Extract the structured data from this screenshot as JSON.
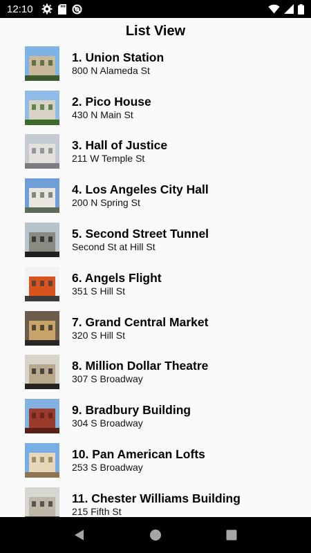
{
  "status": {
    "time": "12:10",
    "left_icons": [
      "gear-icon",
      "sd-card-icon",
      "blocked-circle-icon"
    ],
    "right_icons": [
      "wifi-icon",
      "cellular-signal-icon",
      "battery-icon"
    ]
  },
  "app": {
    "title": "List View"
  },
  "items": [
    {
      "name": "1. Union Station",
      "address": "800 N Alameda St",
      "image": "union-station-photo",
      "colors": {
        "sky": "#7db3e6",
        "main": "#c9b99a",
        "accent": "#3d5b2e"
      }
    },
    {
      "name": "2. Pico House",
      "address": "430 N Main St",
      "image": "pico-house-photo",
      "colors": {
        "sky": "#8fbde8",
        "main": "#d8d2c4",
        "accent": "#3f6b2a"
      }
    },
    {
      "name": "3. Hall of Justice",
      "address": "211 W Temple St",
      "image": "hall-of-justice-photo",
      "colors": {
        "sky": "#c4cbd3",
        "main": "#e3e1dc",
        "accent": "#7a7c80"
      }
    },
    {
      "name": "4. Los Angeles City Hall",
      "address": "200 N Spring St",
      "image": "city-hall-photo",
      "colors": {
        "sky": "#6f9fd8",
        "main": "#e8e6de",
        "accent": "#5d6a5a"
      }
    },
    {
      "name": "5. Second Street Tunnel",
      "address": "Second St at Hill St",
      "image": "second-street-tunnel-photo",
      "colors": {
        "sky": "#b8c4cc",
        "main": "#8a8a82",
        "accent": "#1f1f1f"
      }
    },
    {
      "name": "6. Angels Flight",
      "address": "351 S Hill St",
      "image": "angels-flight-photo",
      "colors": {
        "sky": "#f2f2f2",
        "main": "#d8541e",
        "accent": "#3c3c3c"
      }
    },
    {
      "name": "7. Grand Central Market",
      "address": "320 S Hill St",
      "image": "grand-central-market-photo",
      "colors": {
        "sky": "#6b5c4c",
        "main": "#c9a46a",
        "accent": "#2a2824"
      }
    },
    {
      "name": "8. Million Dollar Theatre",
      "address": "307 S Broadway",
      "image": "million-dollar-theatre-photo",
      "colors": {
        "sky": "#d9d4c8",
        "main": "#b8a88e",
        "accent": "#262320"
      }
    },
    {
      "name": "9. Bradbury Building",
      "address": "304 S Broadway",
      "image": "bradbury-building-photo",
      "colors": {
        "sky": "#82b2e2",
        "main": "#9b3b2c",
        "accent": "#5a2018"
      }
    },
    {
      "name": "10. Pan American Lofts",
      "address": "253 S Broadway",
      "image": "pan-american-lofts-photo",
      "colors": {
        "sky": "#78aee6",
        "main": "#e6d7b8",
        "accent": "#8c7550"
      }
    },
    {
      "name": "11. Chester Williams Building",
      "address": "215 Fifth St",
      "image": "chester-williams-building-photo",
      "colors": {
        "sky": "#d8d6d0",
        "main": "#bdb7a8",
        "accent": "#3a3631"
      }
    }
  ],
  "nav": {
    "back_icon": "triangle-back-icon",
    "home_icon": "circle-home-icon",
    "recents_icon": "square-recents-icon"
  }
}
